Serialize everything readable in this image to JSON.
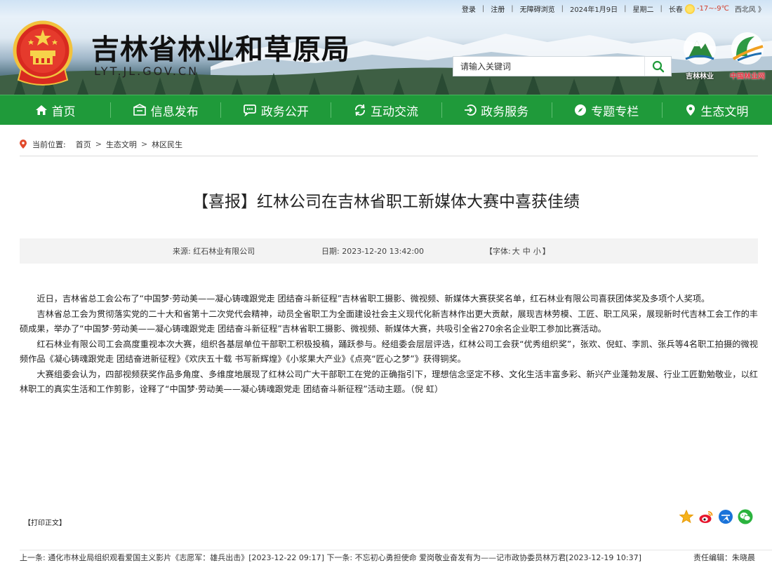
{
  "topbar": {
    "login": "登录",
    "register": "注册",
    "accessible": "无障碍浏览",
    "date": "2024年1月9日",
    "weekday": "星期二",
    "city": "长春",
    "temp": "-17~-9℃",
    "wind": "西北风 》"
  },
  "site": {
    "title": "吉林省林业和草原局",
    "domain": "LYT.JL.GOV.CN"
  },
  "search": {
    "placeholder": "请输入关键词"
  },
  "logos": {
    "jilin": "吉林林业",
    "china": "中国林业网"
  },
  "nav": [
    {
      "label": "首页",
      "icon": "home-icon"
    },
    {
      "label": "信息发布",
      "icon": "info-icon"
    },
    {
      "label": "政务公开",
      "icon": "chat-icon"
    },
    {
      "label": "互动交流",
      "icon": "sync-icon"
    },
    {
      "label": "政务服务",
      "icon": "login-icon"
    },
    {
      "label": "专题专栏",
      "icon": "compass-icon"
    },
    {
      "label": "生态文明",
      "icon": "location-icon"
    }
  ],
  "breadcrumb": {
    "label": "当前位置:",
    "items": [
      "首页",
      "生态文明",
      "林区民生"
    ]
  },
  "article": {
    "title": "【喜报】红林公司在吉林省职工新媒体大赛中喜获佳绩",
    "source": "来源: 红石林业有限公司",
    "date": "日期: 2023-12-20 13:42:00",
    "font_open": "【字体:",
    "font_large": "大",
    "font_medium": "中",
    "font_small": "小",
    "font_close": "】",
    "paragraphs": [
      "近日，吉林省总工会公布了“中国梦·劳动美——凝心铸魂跟党走 团结奋斗新征程”吉林省职工摄影、微视频、新媒体大赛获奖名单，红石林业有限公司喜获团体奖及多项个人奖项。",
      "吉林省总工会为贯彻落实党的二十大和省第十二次党代会精神，动员全省职工为全面建设社会主义现代化新吉林作出更大贡献，展现吉林劳模、工匠、职工风采，展现新时代吉林工会工作的丰硕成果，举办了“中国梦·劳动美——凝心铸魂跟党走 团结奋斗新征程”吉林省职工摄影、微视频、新媒体大赛，共吸引全省270余名企业职工参加比赛活动。",
      "红石林业有限公司工会高度重视本次大赛，组织各基层单位干部职工积极投稿，踊跃参与。经组委会层层评选，红林公司工会获“优秀组织奖”，张欢、倪虹、李凯、张兵等4名职工拍摄的微视频作品《凝心铸魂跟党走 团结奋进新征程》《欢庆五十载 书写新辉煌》《小浆果大产业》《点亮“匠心之梦”》获得铜奖。",
      "大赛组委会认为，四部视频获奖作品多角度、多维度地展现了红林公司广大干部职工在党的正确指引下，理想信念坚定不移、文化生活丰富多彩、新兴产业蓬勃发展、行业工匠勤勉敬业，以红林职工的真实生活和工作剪影，诠释了“中国梦·劳动美——凝心铸魂跟党走 团结奋斗新征程”活动主题。（倪 虹）"
    ]
  },
  "footer": {
    "print": "【打印正文】",
    "prev_label": "上一条:",
    "prev_text": "通化市林业局组织观看爱国主义影片《志愿军：雄兵出击》[2023-12-22 09:17]",
    "next_label": "下一条:",
    "next_text": "不忘初心勇担使命 爱岗敬业奋发有为——记市政协委员林万君[2023-12-19 10:37]",
    "editor": "责任编辑：朱晓晨"
  },
  "colors": {
    "nav_green": "#1f9a3a",
    "accent_red": "#d23c2a"
  }
}
